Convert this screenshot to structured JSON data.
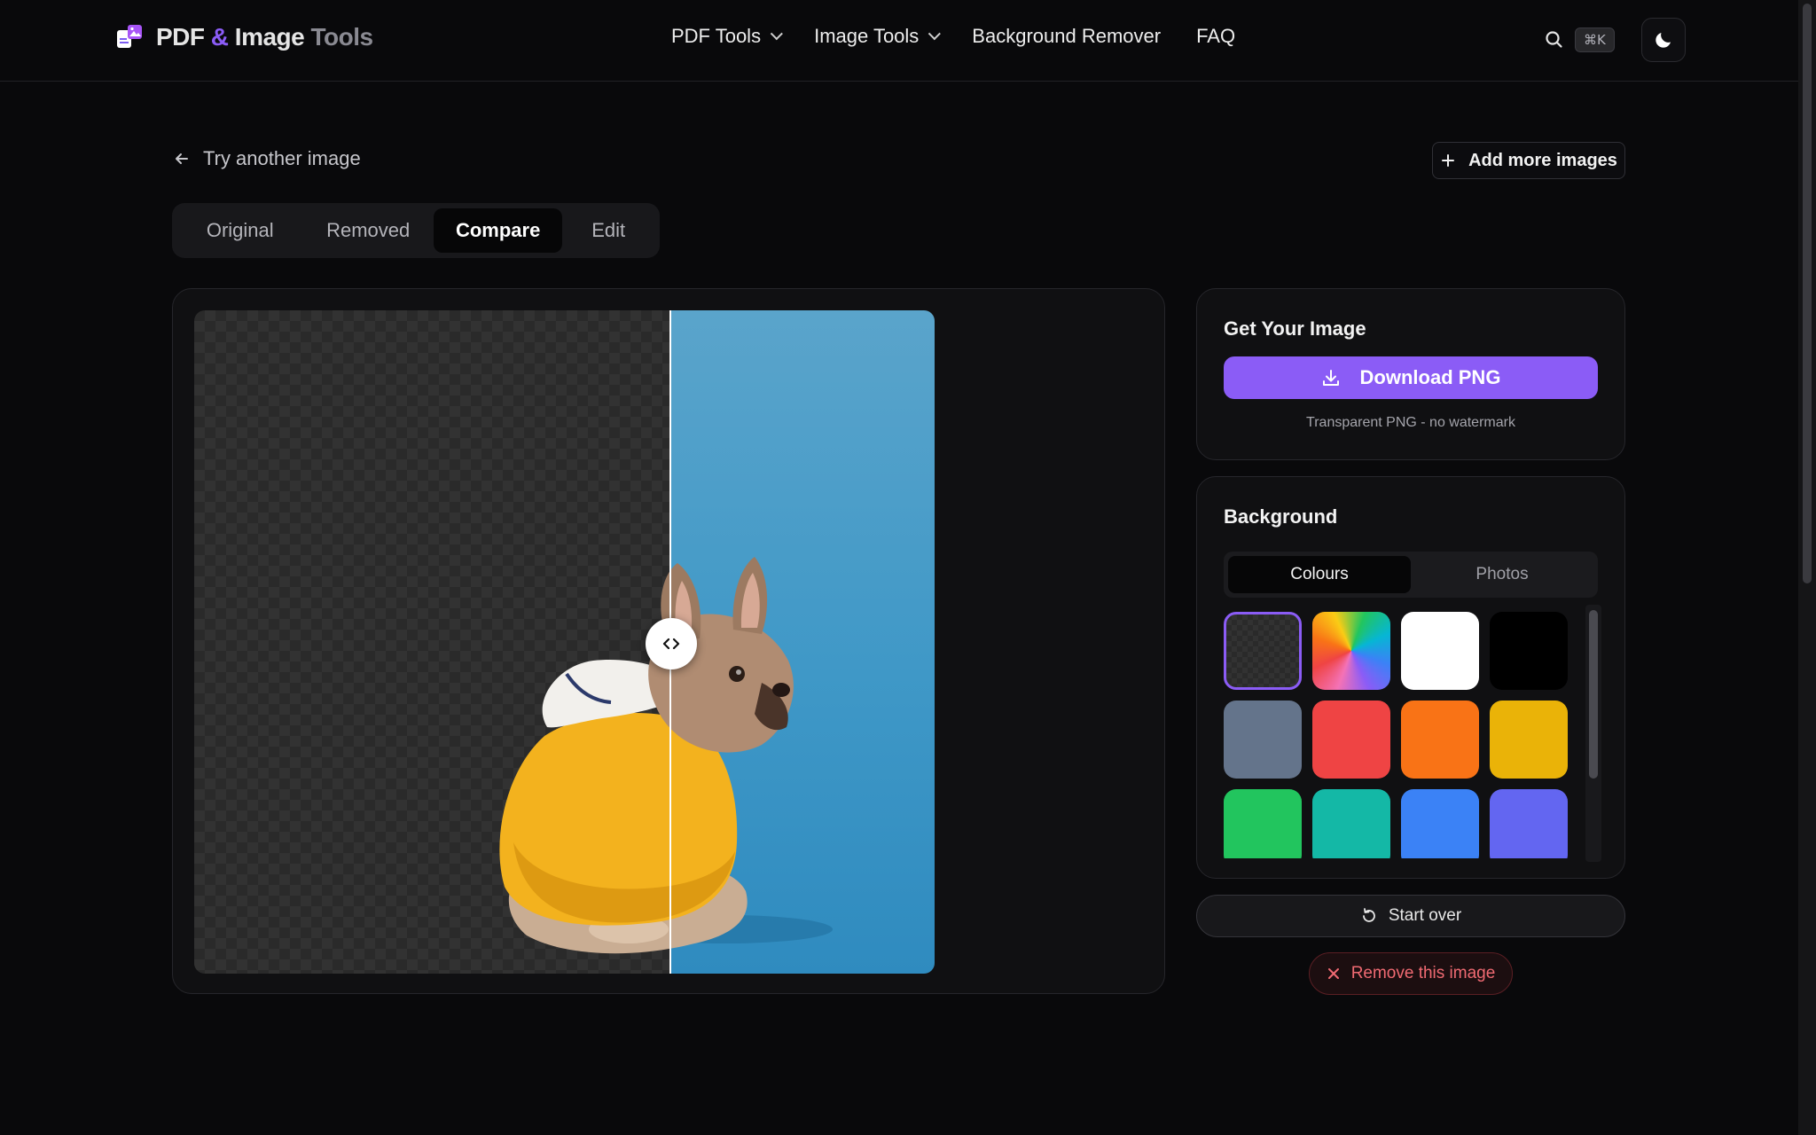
{
  "header": {
    "logo": {
      "part1": "PDF",
      "amp": "&",
      "part2": "Image",
      "part3": "Tools"
    },
    "nav": {
      "pdf_tools": "PDF Tools",
      "image_tools": "Image Tools",
      "bg_remover": "Background Remover",
      "faq": "FAQ"
    },
    "shortcut": "⌘K",
    "icons": {
      "search": "search-icon",
      "theme": "moon-icon"
    }
  },
  "toolbar": {
    "back_label": "Try another image",
    "add_label": "Add more images"
  },
  "view_tabs": {
    "items": [
      "Original",
      "Removed",
      "Compare",
      "Edit"
    ],
    "active": "Compare"
  },
  "compare": {
    "split": 0.643
  },
  "download_card": {
    "title": "Get Your Image",
    "button": "Download PNG",
    "note": "Transparent PNG - no watermark"
  },
  "background_card": {
    "title": "Background",
    "tabs": [
      "Colours",
      "Photos"
    ],
    "active_tab": "Colours",
    "swatches": [
      {
        "name": "transparent",
        "color": "transparent",
        "selected": true
      },
      {
        "name": "rainbow",
        "color": "gradient"
      },
      {
        "name": "white",
        "color": "#ffffff"
      },
      {
        "name": "black",
        "color": "#000000"
      },
      {
        "name": "slate",
        "color": "#64748b"
      },
      {
        "name": "red",
        "color": "#ef4444"
      },
      {
        "name": "orange",
        "color": "#f97316"
      },
      {
        "name": "yellow",
        "color": "#eab308"
      },
      {
        "name": "green",
        "color": "#22c55e"
      },
      {
        "name": "teal",
        "color": "#14b8a6"
      },
      {
        "name": "blue",
        "color": "#3b82f6"
      },
      {
        "name": "indigo",
        "color": "#6366f1"
      }
    ]
  },
  "actions": {
    "start_over": "Start over",
    "remove": "Remove this image"
  },
  "colors": {
    "accent": "#8b5cf6",
    "danger": "#f06a72",
    "background": "#09090b"
  }
}
